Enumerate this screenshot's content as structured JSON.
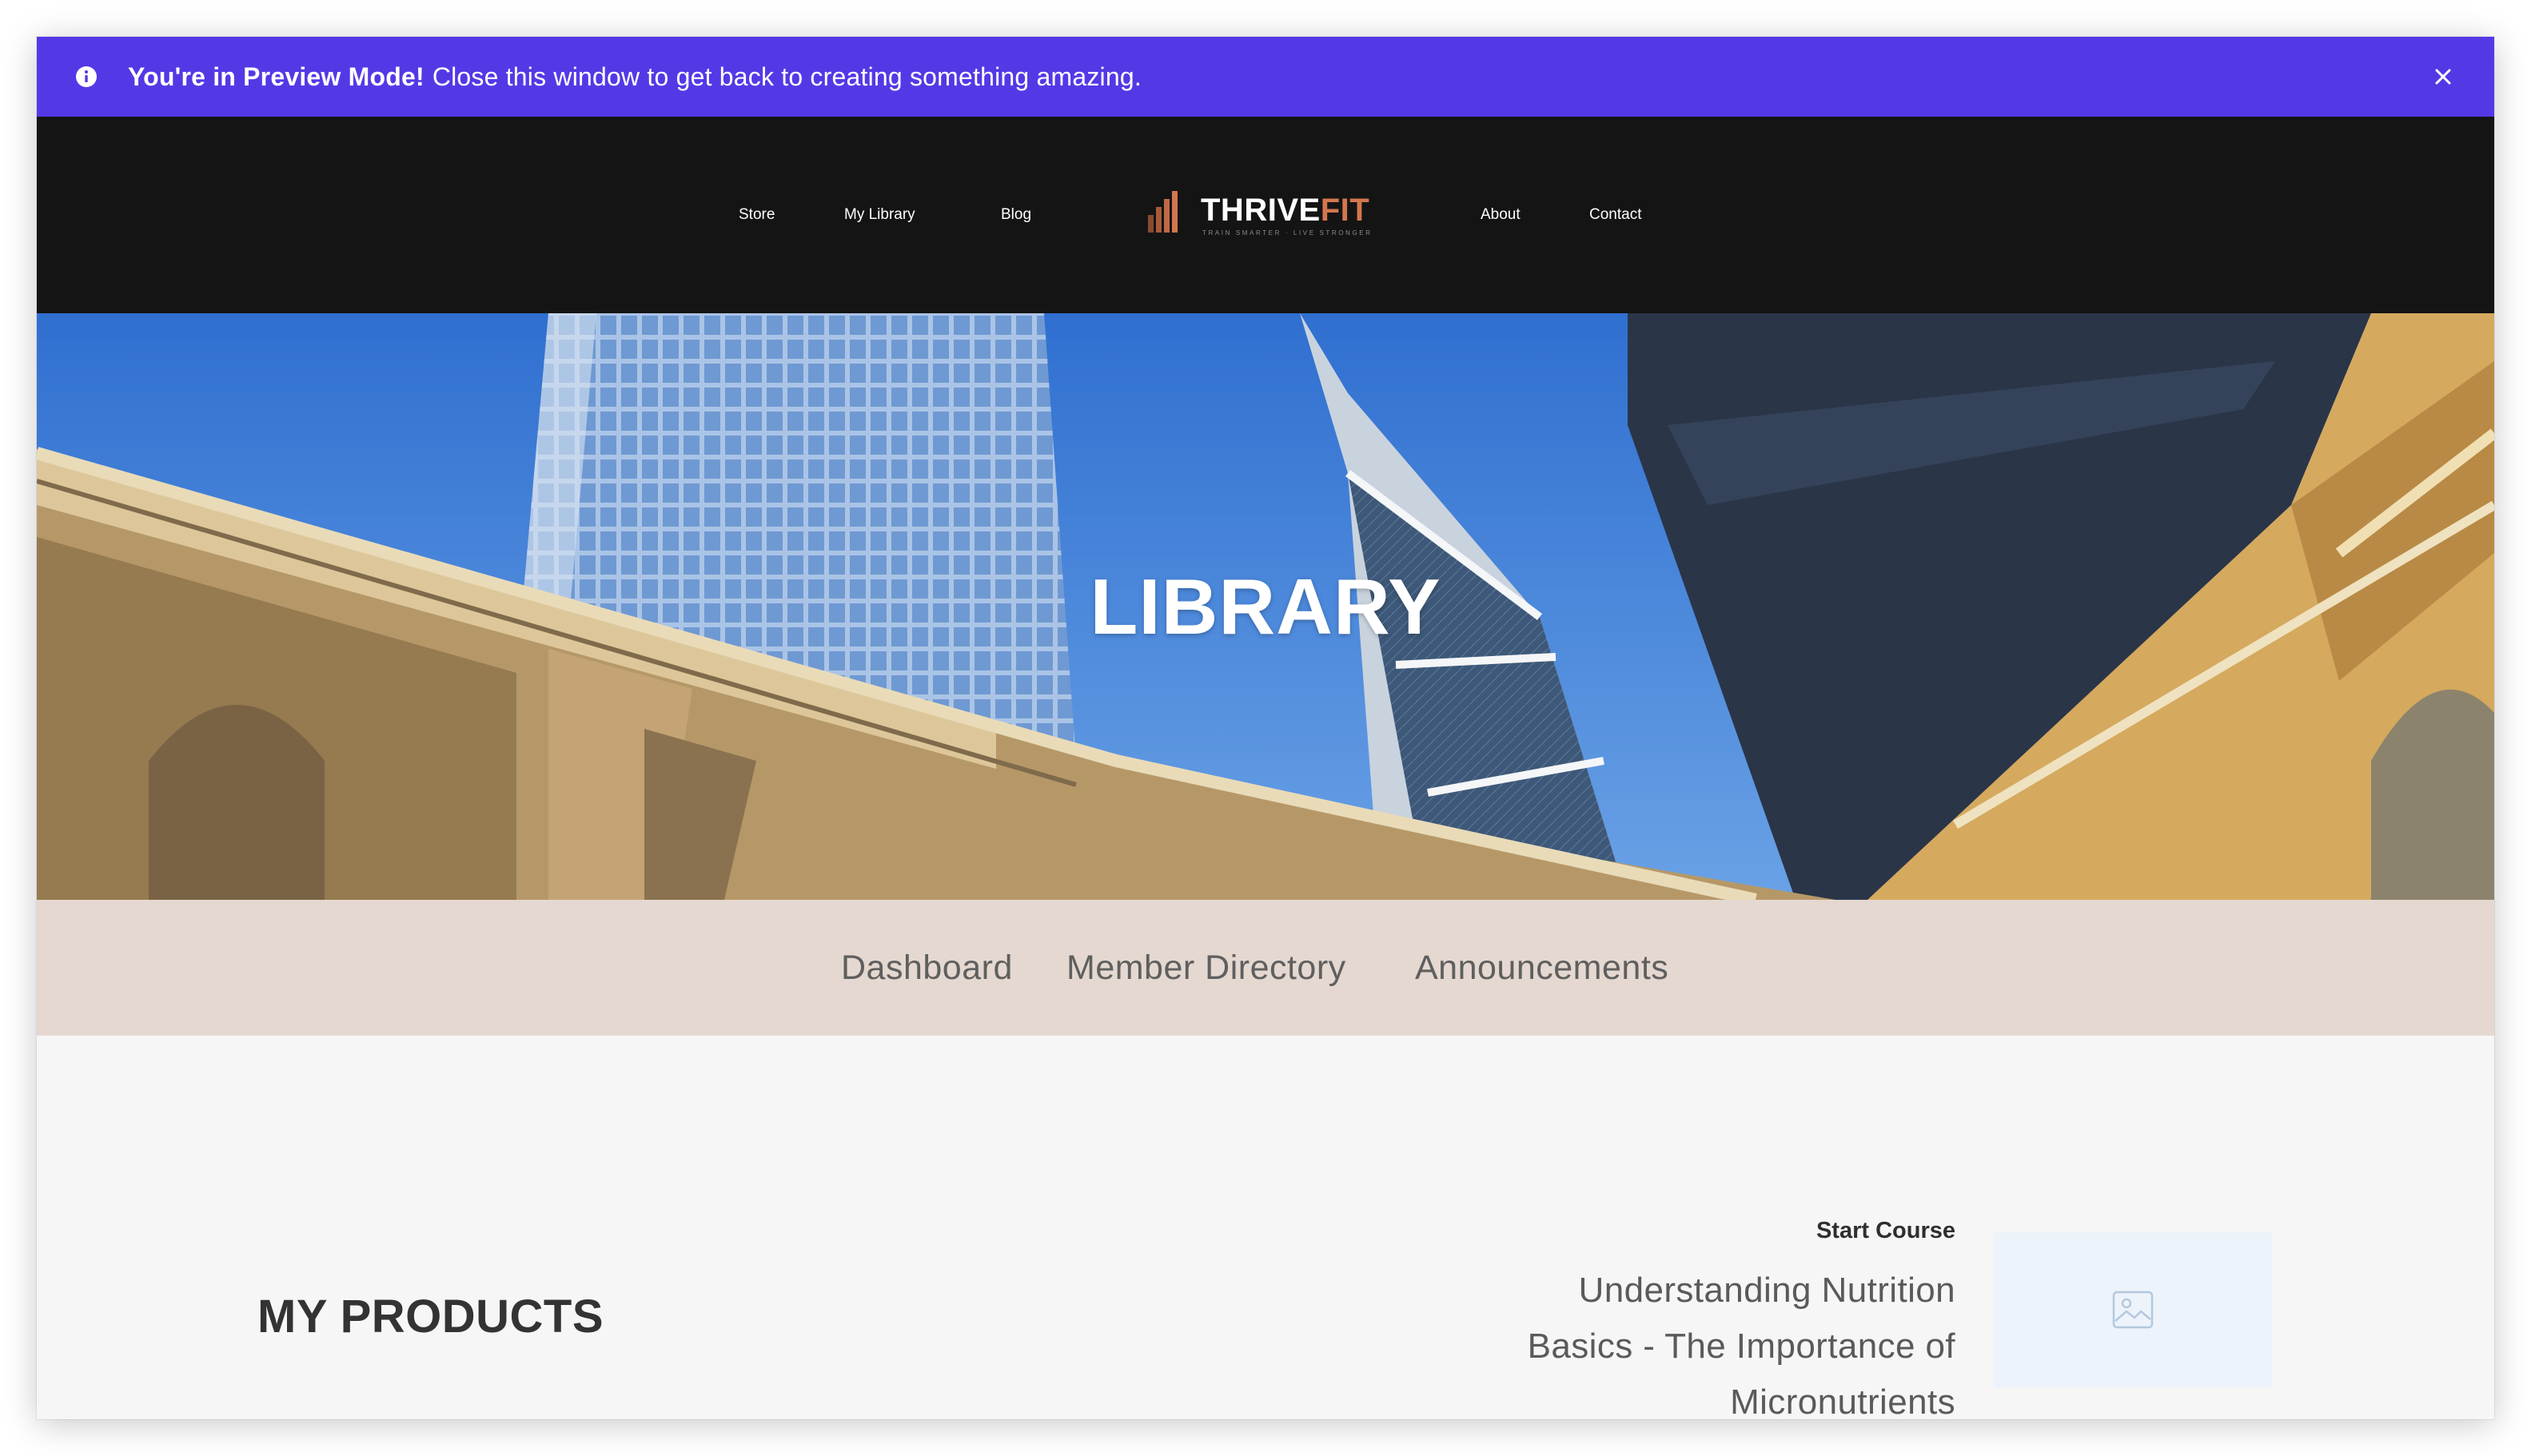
{
  "banner": {
    "bold_text": "You're in Preview Mode!",
    "message": "Close this window to get back to creating something amazing.",
    "info_icon": "info-icon",
    "close_icon": "close-icon",
    "color": "#5339e6"
  },
  "header": {
    "nav_left": [
      "Store",
      "My Library",
      "Blog"
    ],
    "nav_right": [
      "About",
      "Contact"
    ],
    "logo": {
      "word_main": "THRIVE",
      "word_accent": "FIT",
      "tagline": "TRAIN SMARTER · LIVE STRONGER",
      "accent_color": "#d2774e"
    },
    "background": "#141414"
  },
  "hero": {
    "title": "LIBRARY"
  },
  "subnav": {
    "items": [
      "Dashboard",
      "Member Directory",
      "Announcements"
    ],
    "background": "#e4d8d0"
  },
  "products": {
    "section_title": "MY PRODUCTS",
    "course": {
      "action": "Start Course",
      "title": "Understanding Nutrition Basics - The Importance of Micronutrients",
      "thumbnail_icon": "image-placeholder-icon"
    }
  }
}
